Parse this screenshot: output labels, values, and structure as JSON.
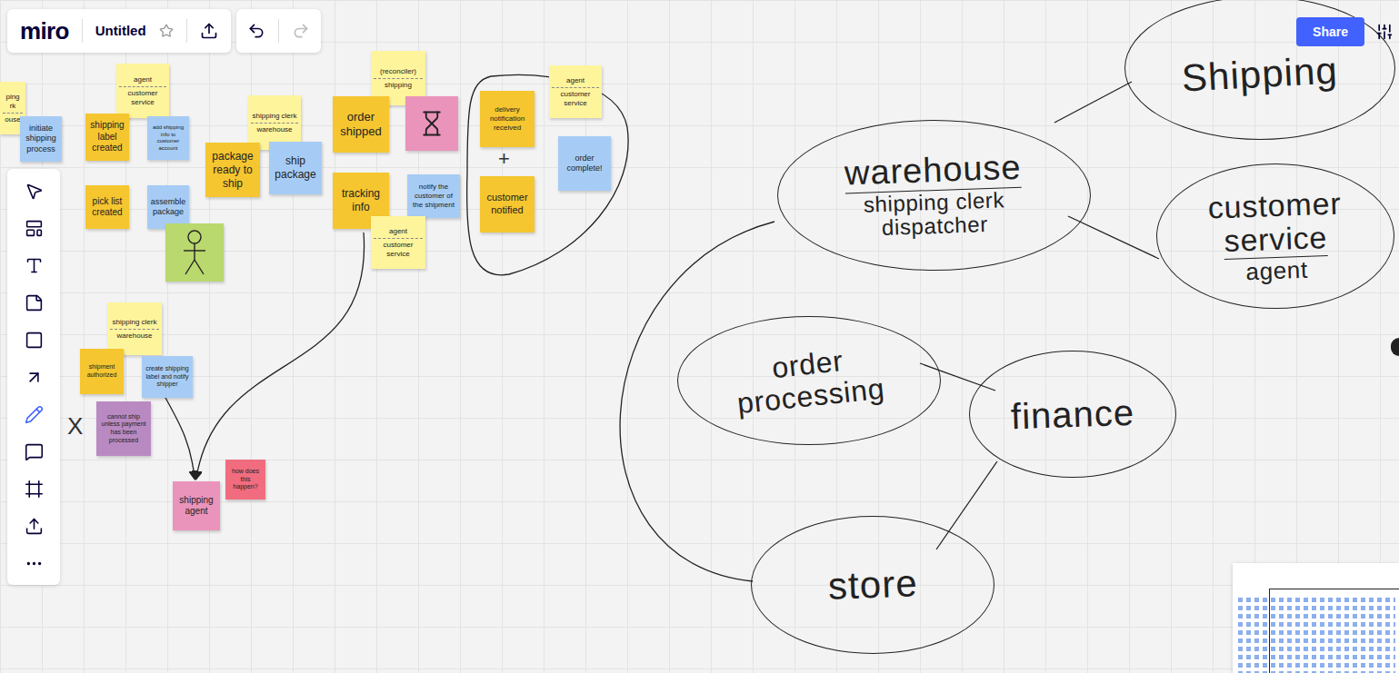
{
  "topbar": {
    "logo": "miro",
    "title": "Untitled",
    "starred": false,
    "undo": {
      "disabled": false
    },
    "redo": {
      "disabled": true
    }
  },
  "share": {
    "label": "Share"
  },
  "toolbar": {
    "tools": [
      {
        "kind": "select",
        "selected": false
      },
      {
        "kind": "templates",
        "selected": false
      },
      {
        "kind": "text",
        "selected": false
      },
      {
        "kind": "sticky",
        "selected": false
      },
      {
        "kind": "shape",
        "selected": false
      },
      {
        "kind": "arrow",
        "selected": false
      },
      {
        "kind": "pen",
        "selected": true
      },
      {
        "kind": "comment",
        "selected": false
      },
      {
        "kind": "frame",
        "selected": false
      },
      {
        "kind": "upload",
        "selected": false
      },
      {
        "kind": "more",
        "selected": false
      }
    ]
  },
  "stickies": [
    {
      "kind": "label",
      "lines": [
        "ping",
        "rk",
        "ouse"
      ],
      "color": "#fef49c"
    },
    {
      "kind": "event",
      "text": "initiate shipping process",
      "color": "#a6ccf5"
    },
    {
      "kind": "label",
      "lines": [
        "agent",
        "customer service"
      ],
      "color": "#fef49c"
    },
    {
      "kind": "event",
      "text": "shipping label created",
      "color": "#f5c62f"
    },
    {
      "kind": "event",
      "text": "add shipping info to customer account",
      "color": "#a6ccf5"
    },
    {
      "kind": "label",
      "lines": [
        "shipping clerk",
        "warehouse"
      ],
      "color": "#fef49c"
    },
    {
      "kind": "event",
      "text": "package ready to ship",
      "color": "#f5c62f"
    },
    {
      "kind": "event",
      "text": "ship package",
      "color": "#a6ccf5"
    },
    {
      "kind": "event",
      "text": "pick list created",
      "color": "#f5c62f"
    },
    {
      "kind": "event",
      "text": "assemble package",
      "color": "#a6ccf5"
    },
    {
      "kind": "person",
      "color": "#b9d86e"
    },
    {
      "kind": "label",
      "lines": [
        "(reconciler)",
        "shipping"
      ],
      "color": "#fef49c"
    },
    {
      "kind": "event",
      "text": "order shipped",
      "color": "#f5c62f"
    },
    {
      "kind": "hourglass",
      "color": "#ea94bb"
    },
    {
      "kind": "event",
      "text": "tracking info",
      "color": "#f5c62f"
    },
    {
      "kind": "event",
      "text": "notify the customer of the shipment",
      "color": "#a6ccf5"
    },
    {
      "kind": "label",
      "lines": [
        "agent",
        "customer service"
      ],
      "color": "#fef49c"
    },
    {
      "kind": "event",
      "text": "delivery notification received",
      "color": "#f5c62f"
    },
    {
      "kind": "event",
      "text": "customer notified",
      "color": "#f5c62f"
    },
    {
      "kind": "label",
      "lines": [
        "agent",
        "customer service"
      ],
      "color": "#fef49c"
    },
    {
      "kind": "event",
      "text": "order complete!",
      "color": "#a6ccf5"
    },
    {
      "kind": "label",
      "lines": [
        "shipping clerk",
        "warehouse"
      ],
      "color": "#fef49c"
    },
    {
      "kind": "event",
      "text": "shipment authorized",
      "color": "#f5c62f"
    },
    {
      "kind": "event",
      "text": "create shipping label and notify shipper",
      "color": "#a6ccf5"
    },
    {
      "kind": "event",
      "text": "cannot ship unless payment has been processed",
      "color": "#b98ac2"
    },
    {
      "kind": "event",
      "text": "shipping agent",
      "color": "#ea94bb"
    },
    {
      "kind": "event",
      "text": "how does this happen?",
      "color": "#f16c7f"
    }
  ],
  "marks": [
    "+",
    "X"
  ],
  "bubbles": [
    {
      "lines": [
        {
          "text": "Shipping",
          "underlined": false
        }
      ]
    },
    {
      "lines": [
        {
          "text": "warehouse",
          "underlined": true
        },
        {
          "text": "shipping clerk",
          "underlined": false
        },
        {
          "text": "dispatcher",
          "underlined": false
        }
      ]
    },
    {
      "lines": [
        {
          "text": "customer",
          "underlined": false
        },
        {
          "text": "service",
          "underlined": true
        },
        {
          "text": "agent",
          "underlined": false
        }
      ]
    },
    {
      "lines": [
        {
          "text": "order",
          "underlined": false
        },
        {
          "text": "processing",
          "underlined": false
        }
      ]
    },
    {
      "lines": [
        {
          "text": "finance",
          "underlined": false
        }
      ]
    },
    {
      "lines": [
        {
          "text": "store",
          "underlined": false
        }
      ]
    }
  ]
}
